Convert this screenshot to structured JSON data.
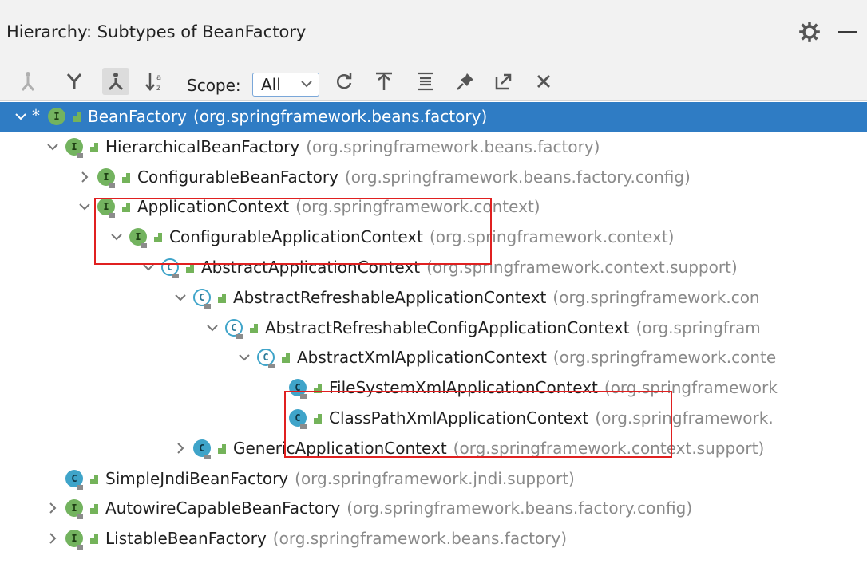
{
  "window": {
    "title": "Hierarchy: Subtypes of BeanFactory"
  },
  "toolbar": {
    "buttons": [
      "supertypes-hierarchy-icon",
      "subtypes-hierarchy-icon",
      "class-hierarchy-icon",
      "sort-alphabetically-icon",
      "refresh-icon",
      "expand-all-icon",
      "collapse-all-icon",
      "pin-icon",
      "export-icon",
      "close-icon"
    ],
    "scope_label": "Scope:",
    "scope_value": "All"
  },
  "tree": {
    "nodes": [
      {
        "name": "BeanFactory",
        "package": "(org.springframework.beans.factory)",
        "kind": "interface",
        "expanded": true,
        "selected": true
      },
      {
        "name": "HierarchicalBeanFactory",
        "package": "(org.springframework.beans.factory)",
        "kind": "interface",
        "expanded": true
      },
      {
        "name": "ConfigurableBeanFactory",
        "package": "(org.springframework.beans.factory.config)",
        "kind": "interface",
        "expanded": false
      },
      {
        "name": "ApplicationContext",
        "package": "(org.springframework.context)",
        "kind": "interface",
        "expanded": true
      },
      {
        "name": "ConfigurableApplicationContext",
        "package": "(org.springframework.context)",
        "kind": "interface",
        "expanded": true
      },
      {
        "name": "AbstractApplicationContext",
        "package": "(org.springframework.context.support)",
        "kind": "abstract",
        "expanded": true
      },
      {
        "name": "AbstractRefreshableApplicationContext",
        "package": "(org.springframework.con",
        "kind": "abstract",
        "expanded": true
      },
      {
        "name": "AbstractRefreshableConfigApplicationContext",
        "package": "(org.springfram",
        "kind": "abstract",
        "expanded": true
      },
      {
        "name": "AbstractXmlApplicationContext",
        "package": "(org.springframework.conte",
        "kind": "abstract",
        "expanded": true
      },
      {
        "name": "FileSystemXmlApplicationContext",
        "package": "(org.springframework",
        "kind": "class"
      },
      {
        "name": "ClassPathXmlApplicationContext",
        "package": "(org.springframework.",
        "kind": "class"
      },
      {
        "name": "GenericApplicationContext",
        "package": "(org.springframework.context.support)",
        "kind": "class",
        "expanded": false
      },
      {
        "name": "SimpleJndiBeanFactory",
        "package": "(org.springframework.jndi.support)",
        "kind": "class"
      },
      {
        "name": "AutowireCapableBeanFactory",
        "package": "(org.springframework.beans.factory.config)",
        "kind": "interface",
        "expanded": false
      },
      {
        "name": "ListableBeanFactory",
        "package": "(org.springframework.beans.factory)",
        "kind": "interface",
        "expanded": false
      }
    ]
  },
  "colors": {
    "selection": "#2f7cc4",
    "interface_badge": "#73b35f",
    "class_badge": "#3fa4c9",
    "highlight_box": "#e02020"
  }
}
